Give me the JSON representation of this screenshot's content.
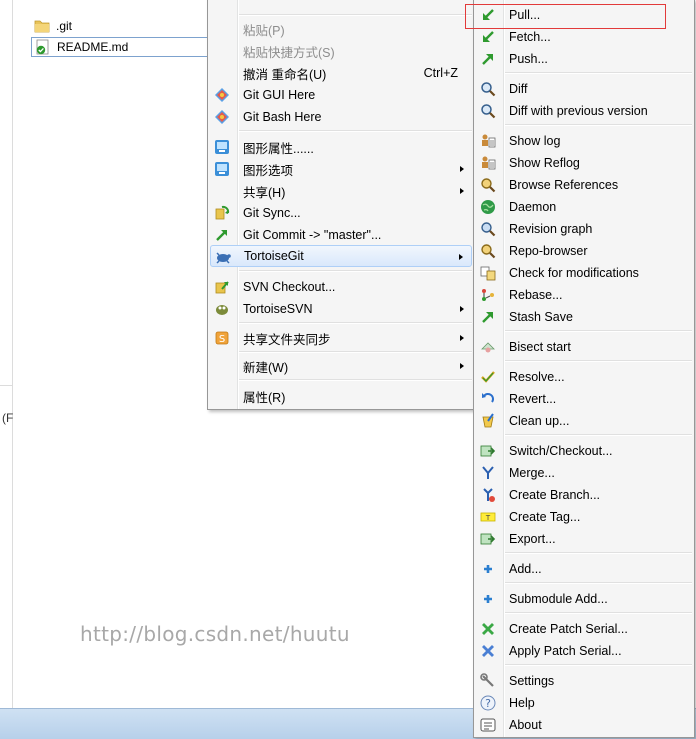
{
  "explorer": {
    "files": [
      {
        "name": ".git",
        "icon": "folder-icon"
      },
      {
        "name": "README.md",
        "icon": "git-status-icon"
      }
    ],
    "left_fragment": "(F",
    "watermark": "http://blog.csdn.net/huutu"
  },
  "context_menu": {
    "items": [
      {
        "label": "粘贴(P)",
        "disabled": true
      },
      {
        "label": "粘贴快捷方式(S)",
        "disabled": true
      },
      {
        "label": "撤消 重命名(U)",
        "shortcut": "Ctrl+Z"
      },
      {
        "label": "Git GUI Here"
      },
      {
        "label": "Git Bash Here"
      },
      {
        "label": "图形属性......"
      },
      {
        "label": "图形选项"
      },
      {
        "label": "共享(H)"
      },
      {
        "label": "Git Sync..."
      },
      {
        "label": "Git Commit -> \"master\"..."
      },
      {
        "label": "TortoiseGit"
      },
      {
        "label": "SVN Checkout..."
      },
      {
        "label": "TortoiseSVN"
      },
      {
        "label": "共享文件夹同步"
      },
      {
        "label": "新建(W)"
      },
      {
        "label": "属性(R)"
      }
    ]
  },
  "tortoisegit_menu": {
    "items": [
      {
        "label": "Pull..."
      },
      {
        "label": "Fetch..."
      },
      {
        "label": "Push..."
      },
      {
        "label": "Diff"
      },
      {
        "label": "Diff with previous version"
      },
      {
        "label": "Show log"
      },
      {
        "label": "Show Reflog"
      },
      {
        "label": "Browse References"
      },
      {
        "label": "Daemon"
      },
      {
        "label": "Revision graph"
      },
      {
        "label": "Repo-browser"
      },
      {
        "label": "Check for modifications"
      },
      {
        "label": "Rebase..."
      },
      {
        "label": "Stash Save"
      },
      {
        "label": "Bisect start"
      },
      {
        "label": "Resolve..."
      },
      {
        "label": "Revert..."
      },
      {
        "label": "Clean up..."
      },
      {
        "label": "Switch/Checkout..."
      },
      {
        "label": "Merge..."
      },
      {
        "label": "Create Branch..."
      },
      {
        "label": "Create Tag..."
      },
      {
        "label": "Export..."
      },
      {
        "label": "Add..."
      },
      {
        "label": "Submodule Add..."
      },
      {
        "label": "Create Patch Serial..."
      },
      {
        "label": "Apply Patch Serial..."
      },
      {
        "label": "Settings"
      },
      {
        "label": "Help"
      },
      {
        "label": "About"
      }
    ]
  },
  "colors": {
    "highlight_box": "#e23a3a",
    "menu_bg": "#f5f5f5",
    "taskbar": "#b7d0ea"
  }
}
